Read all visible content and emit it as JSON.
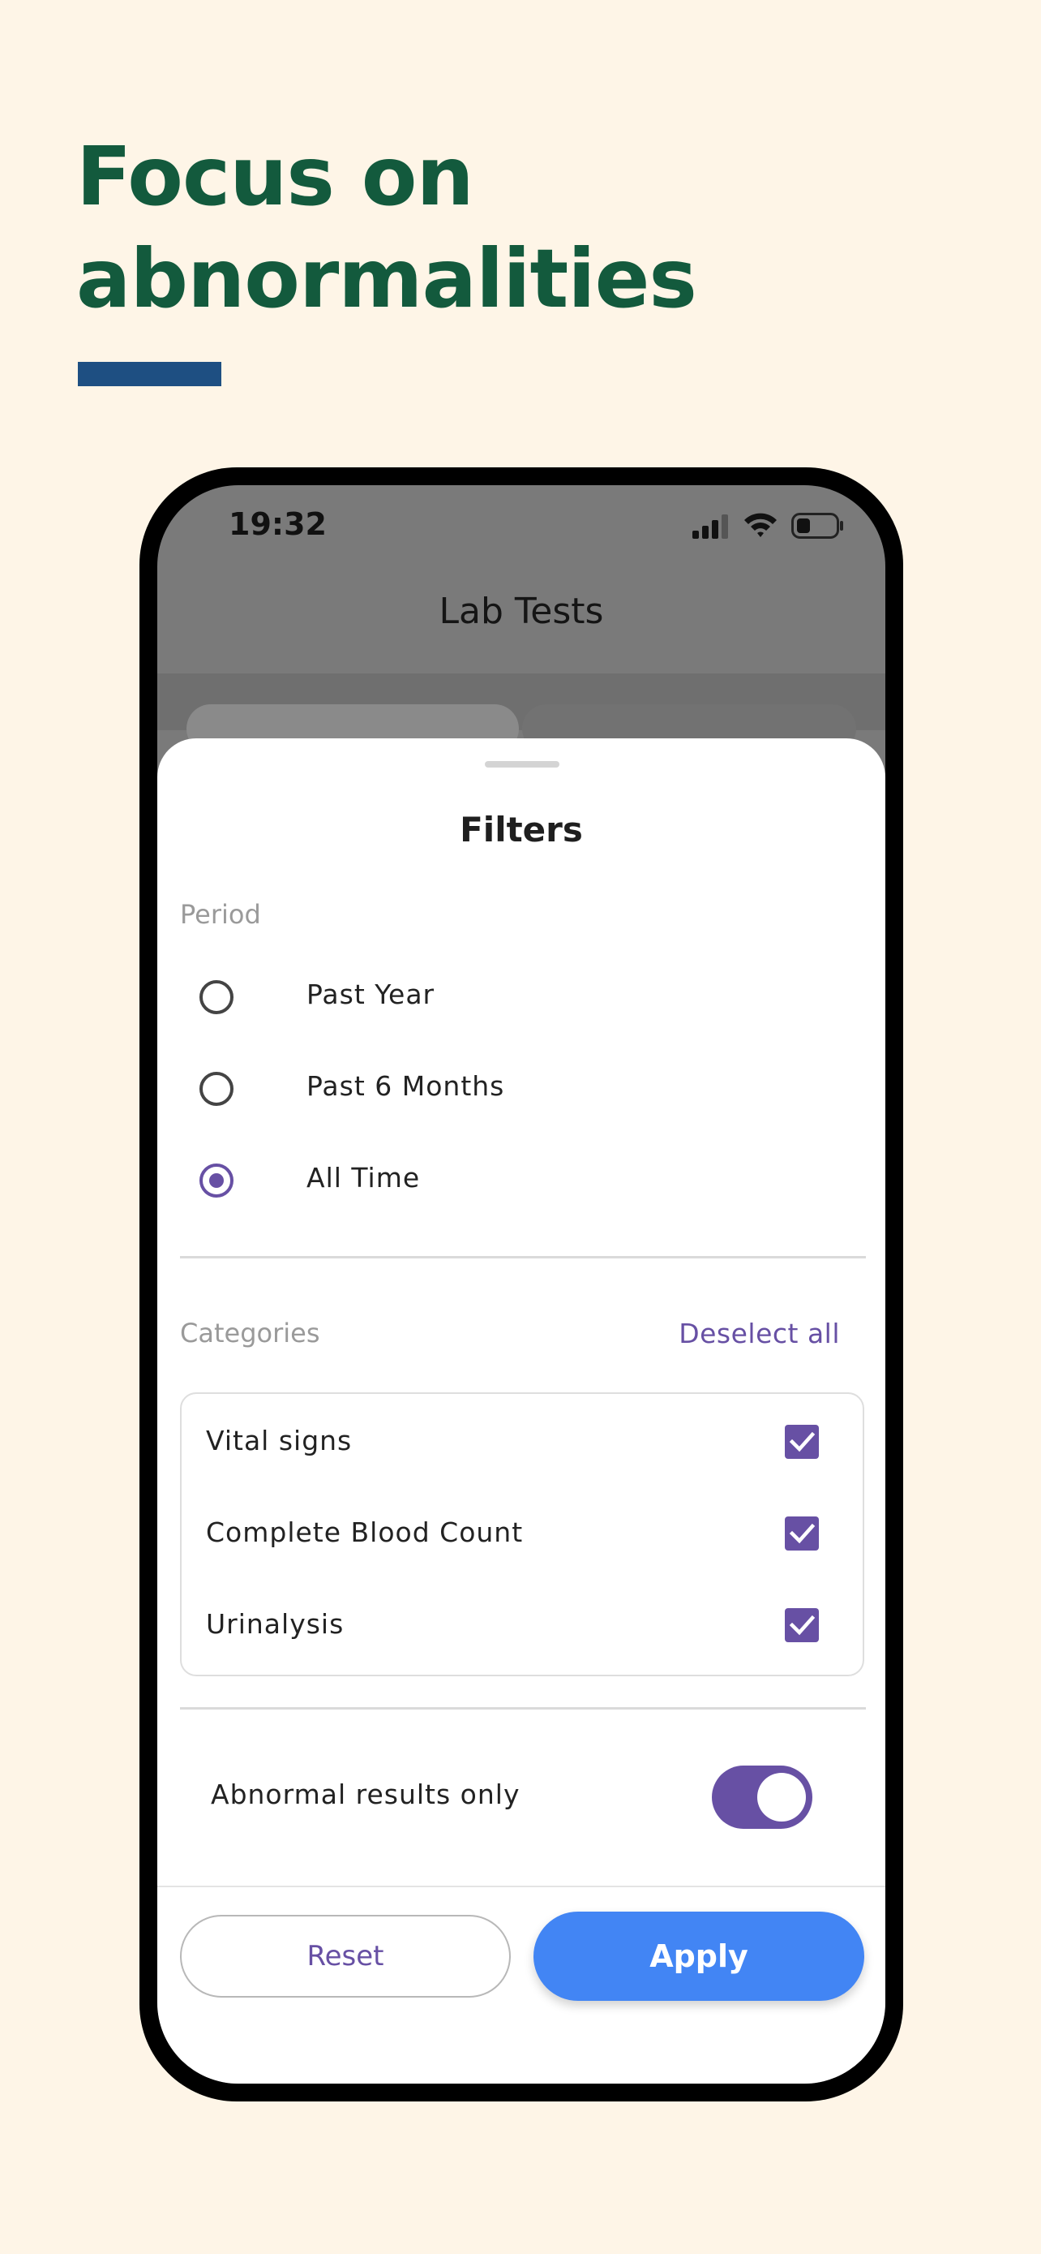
{
  "headline": {
    "line1": "Focus on",
    "line2": "abnormalities"
  },
  "status_bar": {
    "time": "19:32"
  },
  "app_bar": {
    "title": "Lab Tests"
  },
  "filters": {
    "title": "Filters",
    "period": {
      "label": "Period",
      "options": [
        {
          "label": "Past Year",
          "selected": false
        },
        {
          "label": "Past 6 Months",
          "selected": false
        },
        {
          "label": "All Time",
          "selected": true
        }
      ]
    },
    "categories": {
      "label": "Categories",
      "deselect_all": "Deselect all",
      "items": [
        {
          "label": "Vital signs",
          "checked": true
        },
        {
          "label": "Complete Blood Count",
          "checked": true
        },
        {
          "label": "Urinalysis",
          "checked": true
        }
      ]
    },
    "abnormal_only": {
      "label": "Abnormal results only",
      "on": true
    },
    "buttons": {
      "reset": "Reset",
      "apply": "Apply"
    }
  },
  "colors": {
    "background": "#FEF5E7",
    "headline": "#135A3D",
    "accent_bar": "#1E4F82",
    "primary": "#6750A4",
    "apply_button": "#4285F4"
  }
}
